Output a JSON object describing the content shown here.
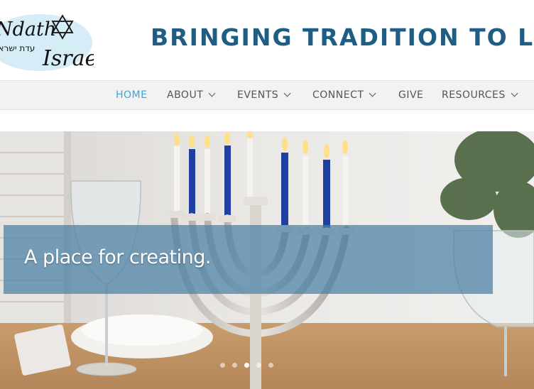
{
  "header": {
    "logo_text_line1": "Ndath",
    "logo_text_line2": "Israel",
    "logo_hebrew": "עדת ישראל",
    "tagline": "BRINGING TRADITION TO LIFE"
  },
  "nav": {
    "items": [
      {
        "label": "HOME",
        "active": true,
        "dropdown": false
      },
      {
        "label": "ABOUT",
        "active": false,
        "dropdown": true
      },
      {
        "label": "EVENTS",
        "active": false,
        "dropdown": true
      },
      {
        "label": "CONNECT",
        "active": false,
        "dropdown": true
      },
      {
        "label": "GIVE",
        "active": false,
        "dropdown": false
      },
      {
        "label": "RESOURCES",
        "active": false,
        "dropdown": true
      }
    ]
  },
  "hero": {
    "caption": "A place for creating.",
    "slides_count": 5,
    "active_slide": 3
  },
  "colors": {
    "brand_blue": "#1e5d84",
    "nav_active": "#3aa6d8",
    "candle_blue": "#1f3fa3"
  }
}
